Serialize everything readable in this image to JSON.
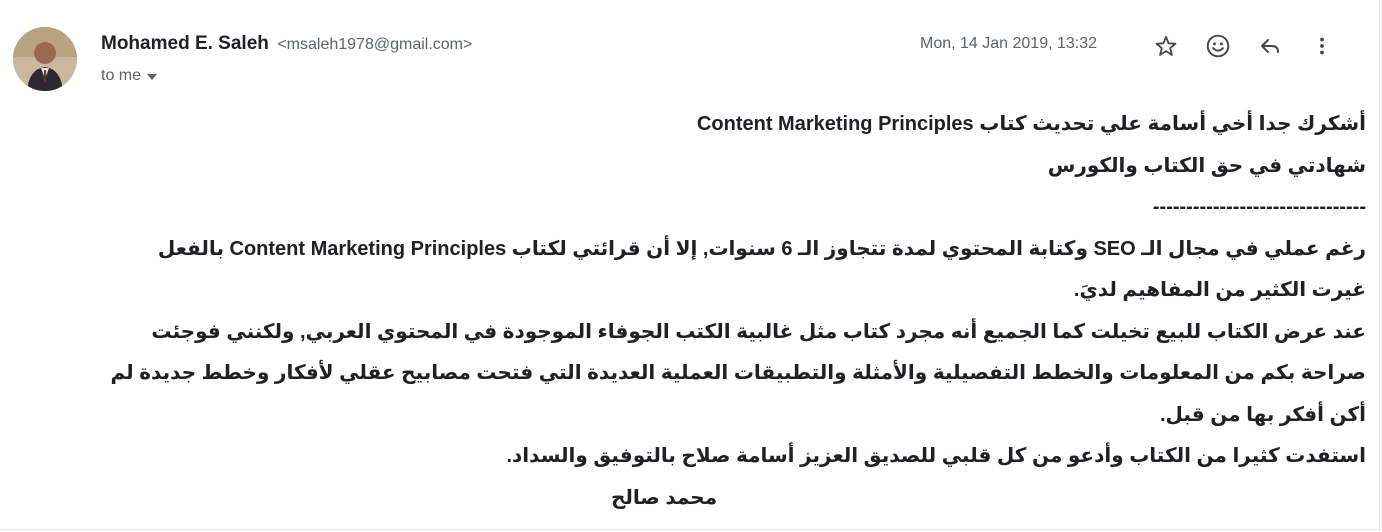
{
  "sender": {
    "name": "Mohamed E. Saleh",
    "email": "<msaleh1978@gmail.com>",
    "to": "to me"
  },
  "date": "Mon, 14 Jan 2019, 13:32",
  "icons": {
    "star": "star-icon",
    "emoji": "emoji-icon",
    "reply": "reply-icon",
    "more": "more-vert-icon",
    "to_dropdown": "caret-down-icon"
  },
  "colors": {
    "text": "#202124",
    "secondary": "#5f6368"
  },
  "body": {
    "line1": "أشكرك جدا أخي أسامة علي تحديث كتاب  Content Marketing Principles",
    "line2": "شهادتي في حق الكتاب والكورس",
    "separator": "--------------------------------",
    "para1": "رغم عملي في مجال الـ SEO وكتابة المحتوي لمدة تتجاوز الـ 6 سنوات, إلا أن قرائتي لكتاب Content Marketing Principles بالفعل غيرت الكثير من المفاهيم لديَ.",
    "para2": "عند عرض الكتاب للبيع تخيلت كما الجميع أنه مجرد كتاب مثل غالبية الكتب الجوفاء الموجودة في المحتوي العربي, ولكنني فوجئت صراحة بكم من المعلومات والخطط التفصيلية والأمثلة والتطبيقات العملية العديدة التي فتحت مصابيح عقلي لأفكار وخطط جديدة لم أكن أفكر بها من قبل.",
    "para3": "استفدت كثيرا من الكتاب وأدعو من كل قلبي للصديق العزيز أسامة صلاح بالتوفيق والسداد.",
    "signature": "محمد صالح"
  }
}
